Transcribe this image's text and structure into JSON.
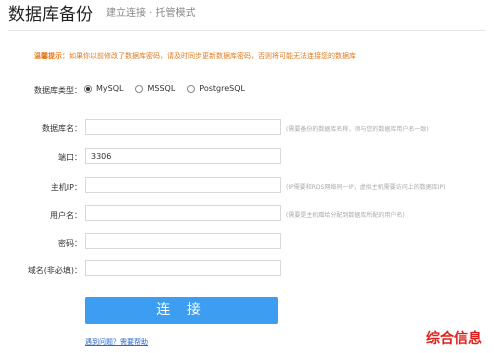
{
  "header": {
    "title": "数据库备份",
    "subtitle": "建立连接 · 托管模式"
  },
  "notice": {
    "label": "温馨提示：",
    "text": "如果你以前修改了数据库密码，请及时同步更新数据库密码，否则将可能无法连接您的数据库"
  },
  "dbtype": {
    "label": "数据库类型：",
    "options": [
      "MySQL",
      "MSSQL",
      "PostgreSQL"
    ],
    "selected": "MySQL"
  },
  "fields": {
    "dbname": {
      "label": "数据库名：",
      "value": "",
      "hint": "(需要备份的数据库名称，须与您的数据库用户名一致)"
    },
    "port": {
      "label": "端口：",
      "value": "3306",
      "hint": ""
    },
    "host": {
      "label": "主机IP：",
      "value": "",
      "hint": "(IP需要和RDS网络同一IP，虚拟主机需要访问上的数据库IP)"
    },
    "user": {
      "label": "用户名：",
      "value": "",
      "hint": "(需要是主机赠给分配到数据库所配的用户名)"
    },
    "password": {
      "label": "密码：",
      "value": "",
      "hint": ""
    },
    "domain": {
      "label": "域名(非必填)：",
      "value": "",
      "hint": ""
    }
  },
  "actions": {
    "connect_label": "连 接",
    "help_link": "遇到问题？需要帮助"
  },
  "brand": {
    "text": "综合信息"
  },
  "colors": {
    "accent": "#3d9df0",
    "notice": "#e07b20",
    "brand": "#e0201b"
  }
}
